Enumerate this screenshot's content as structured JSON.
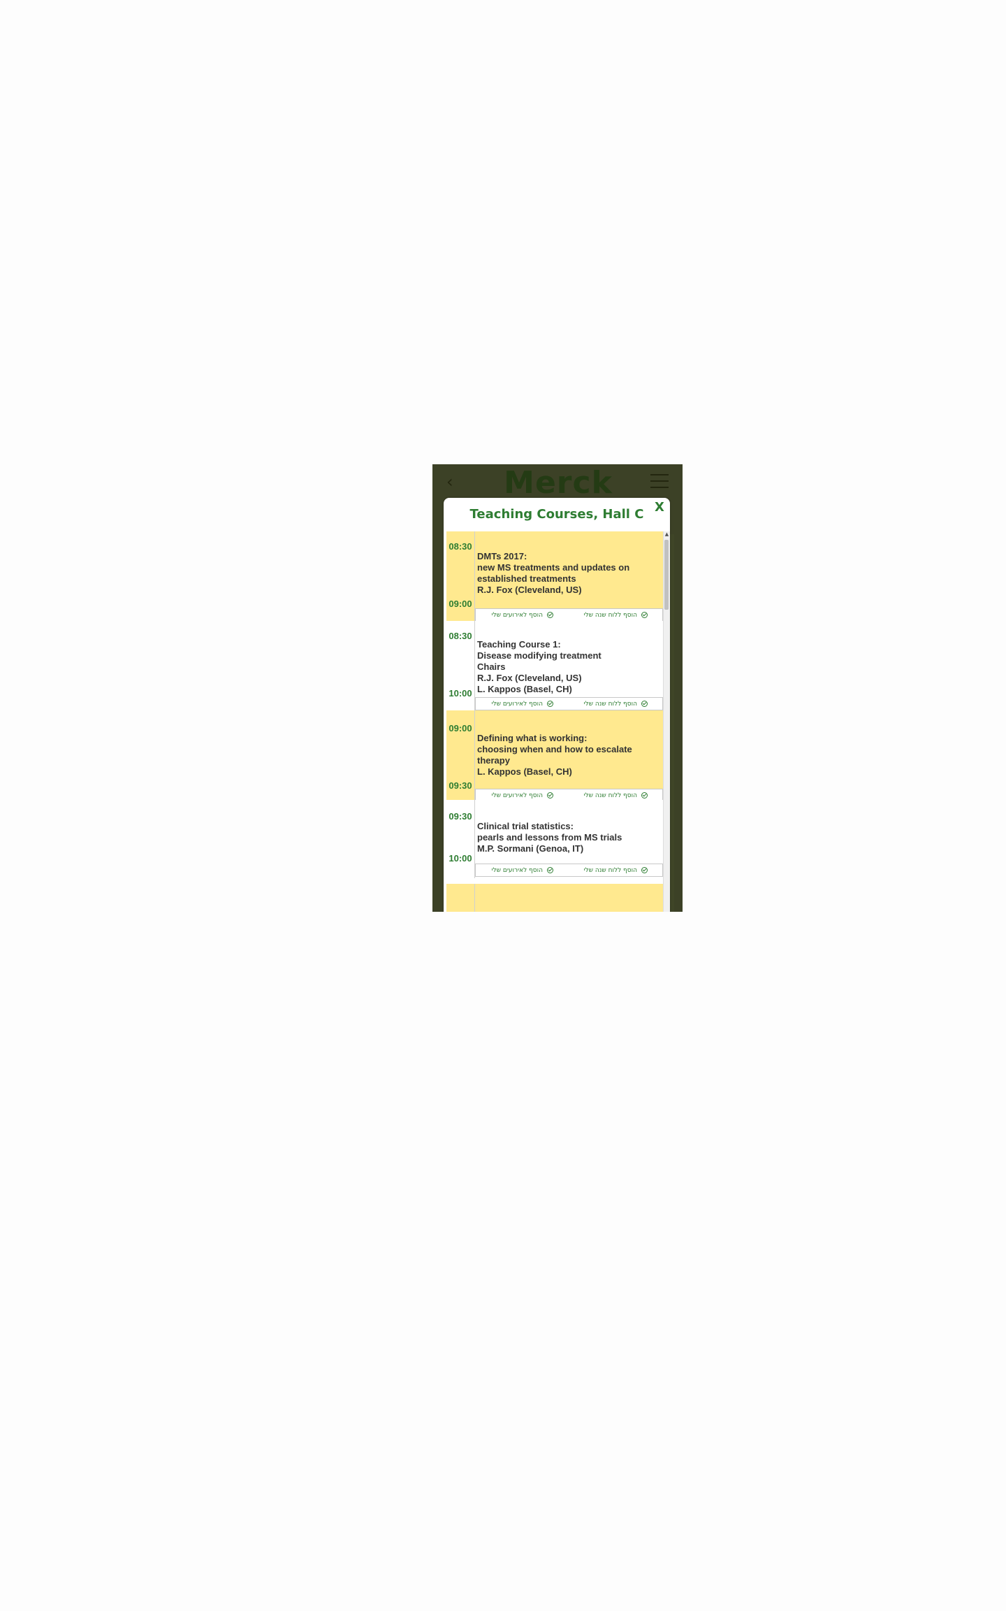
{
  "header": {
    "logo_text": "Merck",
    "back_icon": "chevron-left-icon",
    "menu_icon": "hamburger-icon"
  },
  "modal": {
    "title": "Teaching Courses, Hall C",
    "close_label": "X"
  },
  "actions": {
    "add_calendar": "הוסף ללוח שנה שלי",
    "add_events": "הוסף לאירועים שלי"
  },
  "sessions": [
    {
      "start": "08:30",
      "end": "09:00",
      "lines": [
        "DMTs 2017:",
        "new MS treatments and updates on",
        "established treatments",
        "R.J. Fox (Cleveland, US)"
      ]
    },
    {
      "start": "08:30",
      "end": "10:00",
      "lines": [
        "Teaching Course 1:",
        "Disease modifying treatment",
        "Chairs",
        "R.J. Fox (Cleveland, US)",
        "L. Kappos (Basel, CH)"
      ]
    },
    {
      "start": "09:00",
      "end": "09:30",
      "lines": [
        "Defining what is working:",
        "choosing when and how to escalate",
        "therapy",
        "L. Kappos (Basel, CH)"
      ]
    },
    {
      "start": "09:30",
      "end": "10:00",
      "lines": [
        "Clinical trial statistics:",
        "pearls and lessons from MS trials",
        "M.P. Sormani (Genoa, IT)"
      ]
    }
  ],
  "colors": {
    "accent": "#2e7d32",
    "highlight": "#ffe98f",
    "overlay": "#3c4126"
  }
}
